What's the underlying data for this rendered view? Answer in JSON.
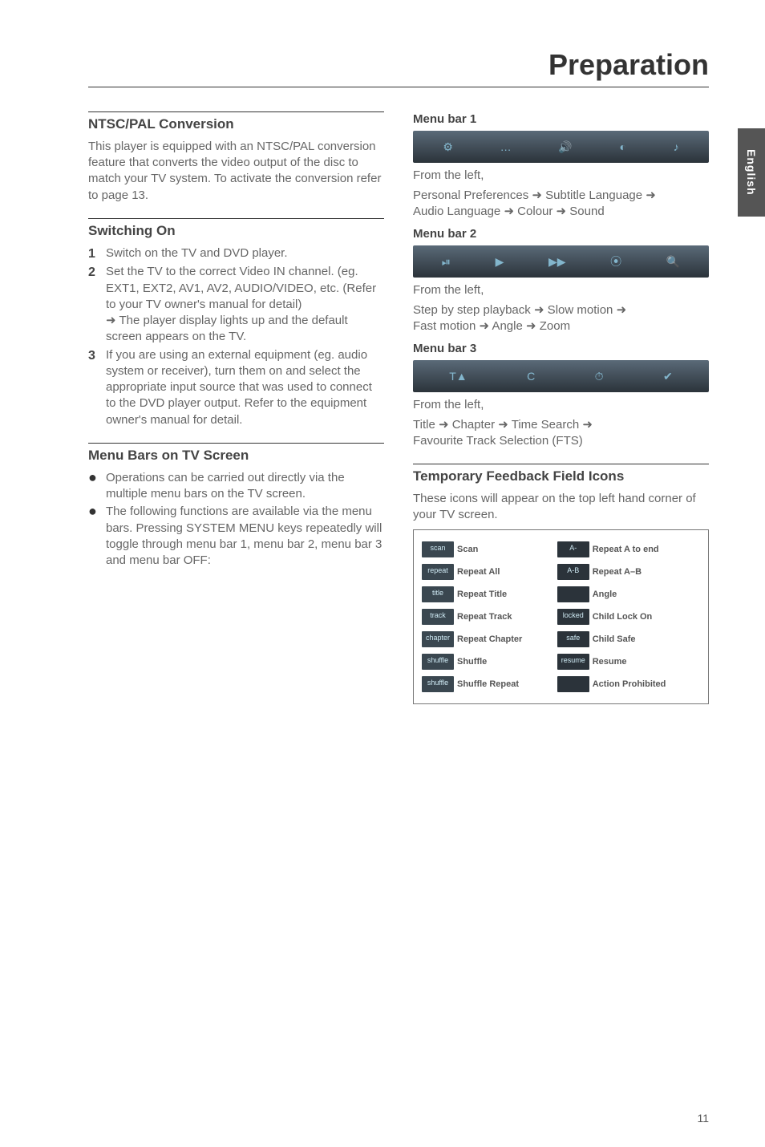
{
  "chapter_title": "Preparation",
  "side_tab": "English",
  "page_number": "11",
  "left": {
    "s1_title": "NTSC/PAL Conversion",
    "s1_p1": "This player is equipped with an NTSC/PAL conversion feature that converts the video output of the disc to match your TV system.  To activate the conversion refer to page 13.",
    "s2_title": "Switching On",
    "s2_step1": "Switch on the TV and DVD player.",
    "s2_step2": "Set the TV to the correct Video IN channel. (eg. EXT1, EXT2, AV1, AV2, AUDIO/VIDEO, etc. (Refer to your TV owner's manual for detail)",
    "s2_step2b": "➜ The player display lights up and the default screen appears on the TV.",
    "s2_step3": "If you are using an external equipment (eg. audio system or receiver), turn them on and select the appropriate input source that was used to connect to the DVD player output. Refer to the equipment owner's manual for detail.",
    "s3_title": "Menu Bars on TV Screen",
    "s3_b1": "Operations can be carried out directly via the multiple menu bars on the TV screen.",
    "s3_b2": "The following functions are available via the menu bars. Pressing SYSTEM MENU keys repeatedly will toggle through menu bar 1, menu bar 2, menu bar 3 and menu bar OFF:"
  },
  "right": {
    "mb1_title": "Menu bar 1",
    "mb1_from": "From the left,",
    "mb1_line1a": "Personal Preferences ",
    "mb1_line1b": " Subtitle Language ",
    "mb1_line2a": "Audio Language ",
    "mb1_line2b": " Colour ",
    "mb1_line2c": " Sound",
    "mb2_title": "Menu bar 2",
    "mb2_from": "From the left,",
    "mb2_line1a": "Step by step playback ",
    "mb2_line1b": " Slow motion ",
    "mb2_line2a": "Fast motion ",
    "mb2_line2b": " Angle ",
    "mb2_line2c": " Zoom",
    "mb3_title": "Menu bar 3",
    "mb3_from": "From the left,",
    "mb3_line1a": "Title ",
    "mb3_line1b": " Chapter ",
    "mb3_line1c": " Time Search ",
    "mb3_line2": "Favourite Track Selection (FTS)",
    "tf_title": "Temporary Feedback Field Icons",
    "tf_p": "These icons will appear on the top left hand corner of your TV screen.",
    "icons": {
      "c1": [
        "Scan",
        "Repeat All",
        "Repeat Title",
        "Repeat Track",
        "Repeat Chapter",
        "Shuffle",
        "Shuffle Repeat"
      ],
      "c1chips": [
        "scan",
        "repeat",
        "title",
        "track",
        "chapter",
        "shuffle",
        "shuffle"
      ],
      "c2": [
        "Repeat A to end",
        "Repeat A–B",
        "Angle",
        "Child Lock On",
        "Child Safe",
        "Resume",
        "Action Prohibited"
      ],
      "c2chips": [
        "A-",
        "A-B",
        "",
        "locked",
        "safe",
        "resume",
        ""
      ]
    },
    "arrows": "➜"
  }
}
